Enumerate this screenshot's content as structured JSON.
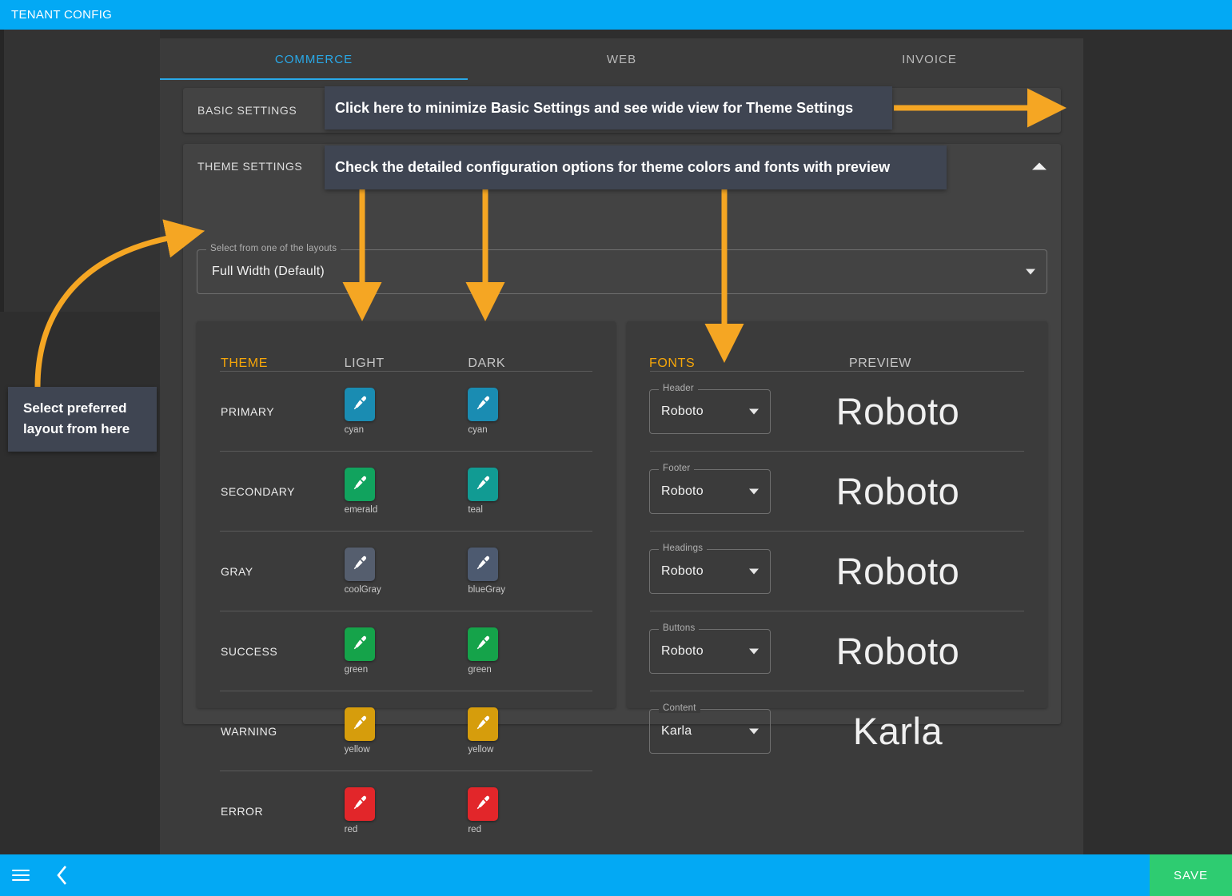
{
  "window": {
    "title": "TENANT CONFIG"
  },
  "tabs": [
    {
      "label": "COMMERCE",
      "active": true
    },
    {
      "label": "WEB",
      "active": false
    },
    {
      "label": "INVOICE",
      "active": false
    }
  ],
  "accordions": {
    "basic": {
      "title": "BASIC SETTINGS",
      "caret": "chevron-down-icon",
      "expanded": false
    },
    "theme": {
      "title": "THEME SETTINGS",
      "caret": "chevron-up-icon",
      "expanded": true
    }
  },
  "layout_select": {
    "legend": "Select from one of the layouts",
    "value": "Full Width (Default)",
    "caret": "chevron-down-icon"
  },
  "theme_table": {
    "headers": {
      "name": "THEME",
      "light": "LIGHT",
      "dark": "DARK"
    },
    "rows": [
      {
        "label": "PRIMARY",
        "light_name": "cyan",
        "light_color": "#1a8cb2",
        "dark_name": "cyan",
        "dark_color": "#1a8cb2"
      },
      {
        "label": "SECONDARY",
        "light_name": "emerald",
        "light_color": "#11a35e",
        "dark_name": "teal",
        "dark_color": "#119b93"
      },
      {
        "label": "GRAY",
        "light_name": "coolGray",
        "light_color": "#555e6e",
        "dark_name": "blueGray",
        "dark_color": "#4d5a70"
      },
      {
        "label": "SUCCESS",
        "light_name": "green",
        "light_color": "#15a34a",
        "dark_name": "green",
        "dark_color": "#15a34a"
      },
      {
        "label": "WARNING",
        "light_name": "yellow",
        "light_color": "#d69d0c",
        "dark_name": "yellow",
        "dark_color": "#d69d0c"
      },
      {
        "label": "ERROR",
        "light_name": "red",
        "light_color": "#e2262a",
        "dark_name": "red",
        "dark_color": "#e2262a"
      }
    ]
  },
  "fonts_table": {
    "headers": {
      "fonts": "FONTS",
      "preview": "PREVIEW"
    },
    "rows": [
      {
        "legend": "Header",
        "value": "Roboto",
        "preview": "Roboto"
      },
      {
        "legend": "Footer",
        "value": "Roboto",
        "preview": "Roboto"
      },
      {
        "legend": "Headings",
        "value": "Roboto",
        "preview": "Roboto"
      },
      {
        "legend": "Buttons",
        "value": "Roboto",
        "preview": "Roboto"
      },
      {
        "legend": "Content",
        "value": "Karla",
        "preview": "Karla"
      }
    ]
  },
  "annotations": {
    "basic_hint": "Click here to minimize Basic Settings and see wide view for Theme Settings",
    "theme_hint": "Check the detailed configuration options for theme colors and fonts with preview",
    "layout_hint_line1": "Select preferred",
    "layout_hint_line2": "layout from here"
  },
  "bottombar": {
    "menu_icon": "hamburger-menu-icon",
    "back_icon": "chevron-left-icon",
    "save_label": "SAVE"
  },
  "colors": {
    "brand_blue": "#03a9f4",
    "accent_amber": "#f6a609",
    "save_green": "#2ecc71",
    "callout_bg": "#3f4552",
    "arrow_orange": "#f5a623"
  }
}
